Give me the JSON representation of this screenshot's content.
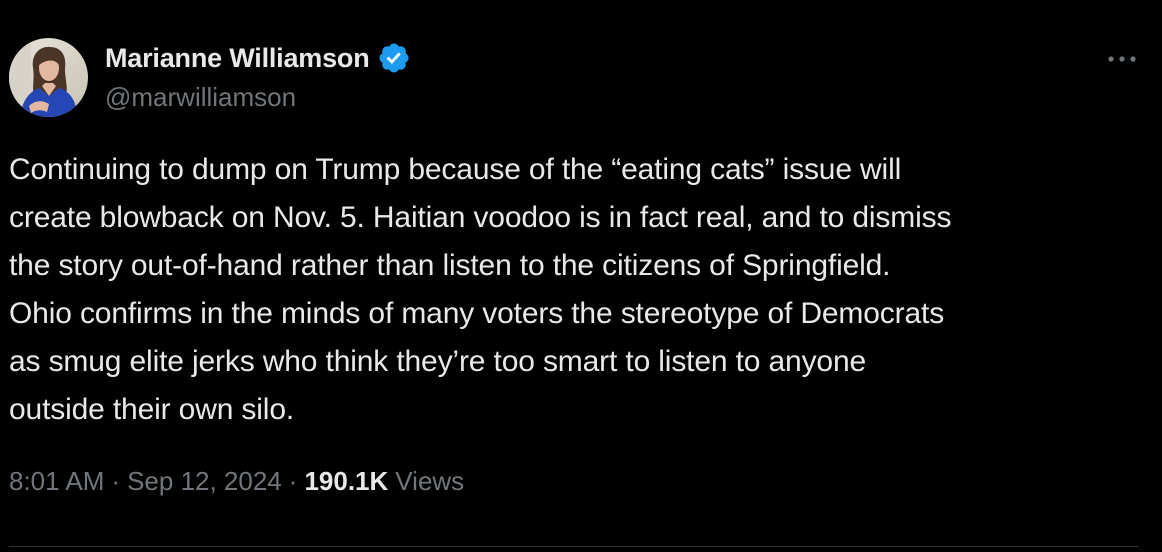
{
  "author": {
    "display_name": "Marianne Williamson",
    "handle": "@marwilliamson",
    "verified_icon": "verified-badge-icon",
    "avatar_icon": "avatar"
  },
  "tweet": {
    "text": "Continuing to dump on Trump because of the “eating cats” issue will\ncreate blowback on Nov. 5. Haitian voodoo is in fact real, and to dismiss\nthe story out-of-hand rather than listen to the citizens of Springfield.\nOhio confirms in the minds of many voters the stereotype of Democrats\nas smug elite jerks who think they’re too smart to listen to anyone\noutside their own silo."
  },
  "meta": {
    "time": "8:01 AM",
    "separator": "·",
    "date": "Sep 12, 2024",
    "views_count": "190.1K",
    "views_label": "Views"
  },
  "colors": {
    "background": "#000000",
    "primary_text": "#e7e9ea",
    "secondary_text": "#71767b",
    "verified_blue": "#1d9bf0",
    "divider": "#2f3336"
  },
  "icons": {
    "more": "more-options-icon"
  }
}
